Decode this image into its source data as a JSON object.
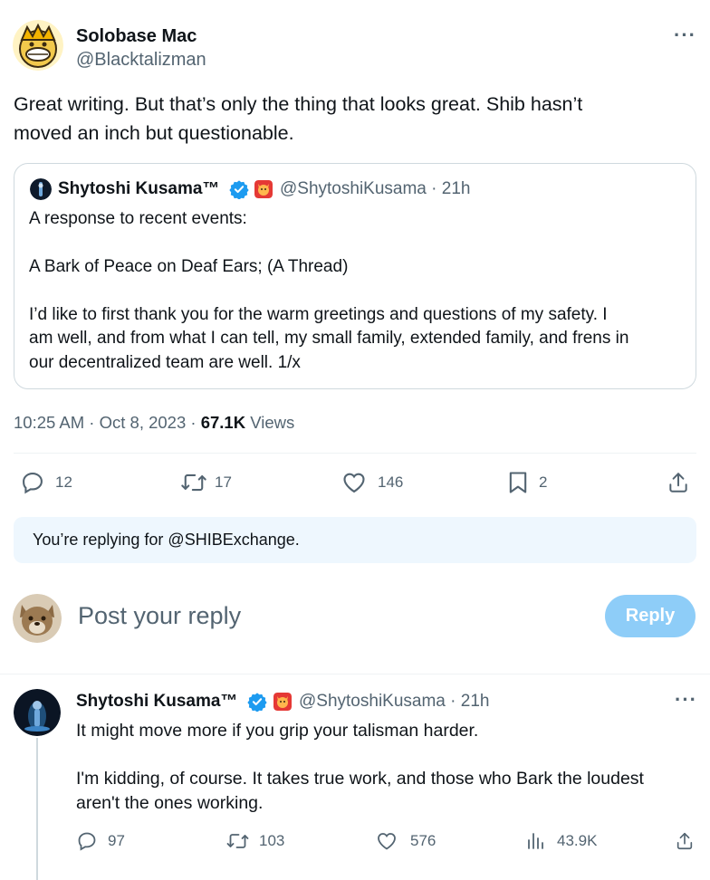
{
  "tweet": {
    "author_name": "Solobase Mac",
    "author_handle": "@Blacktalizman",
    "more_icon": "more-icon",
    "text_line1": "Great writing. But that’s only the thing that looks great. Shib hasn’t",
    "text_line2": "moved an inch but questionable.",
    "timestamp": "10:25 AM · Oct 8, 2023 · ",
    "views_count": "67.1K",
    "views_label": " Views",
    "actions": {
      "replies": "12",
      "retweets": "17",
      "likes": "146",
      "bookmarks": "2"
    }
  },
  "quote": {
    "author_name": "Shytoshi Kusama™",
    "author_handle": "@ShytoshiKusama · 21h",
    "line1": "A response to recent events:",
    "line2": "A Bark of Peace on Deaf Ears; (A Thread)",
    "line3": "I’d like to first thank you for the warm greetings and questions of my safety. I",
    "line4": "am well, and from what I can tell, my small family, extended family, and frens in",
    "line5": "our decentralized team are well. 1/x"
  },
  "composer": {
    "replying_notice": "You’re replying for @SHIBExchange.",
    "placeholder": "Post your reply",
    "reply_button": "Reply"
  },
  "reply": {
    "author_name": "Shytoshi Kusama™",
    "author_handle": "@ShytoshiKusama · 21h",
    "line1": "It might move more if you grip your talisman harder.",
    "line2": "I'm kidding, of course. It takes true work, and those who Bark the loudest",
    "line3": "aren't the ones working.",
    "actions": {
      "replies": "97",
      "retweets": "103",
      "likes": "576",
      "views": "43.9K"
    }
  },
  "colors": {
    "verified_blue": "#1d9bf0",
    "reply_button_bg": "#8ecdf8",
    "replying_notice_bg": "#eef7fe"
  }
}
